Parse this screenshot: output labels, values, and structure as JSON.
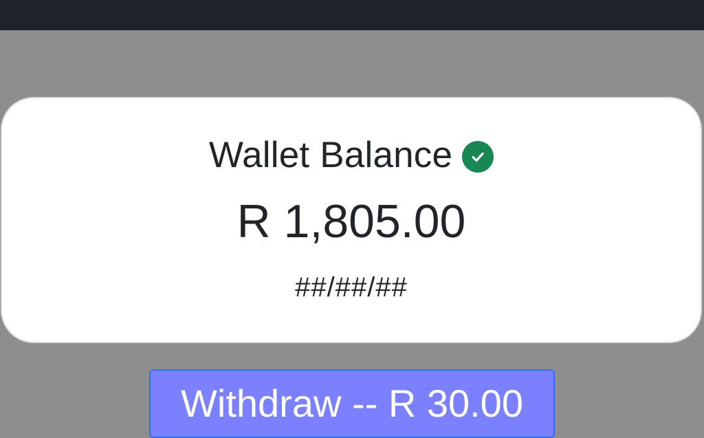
{
  "wallet": {
    "title": "Wallet Balance",
    "verified_icon": "check-circle-icon",
    "verified_color": "#198754",
    "balance": "R 1,805.00",
    "date": "##/##/##"
  },
  "actions": {
    "withdraw_label": "Withdraw -- R 30.00",
    "withdraw_color": "#7b80ff"
  },
  "colors": {
    "topbar": "#202329",
    "background": "#8e8e8e",
    "card": "#ffffff"
  }
}
